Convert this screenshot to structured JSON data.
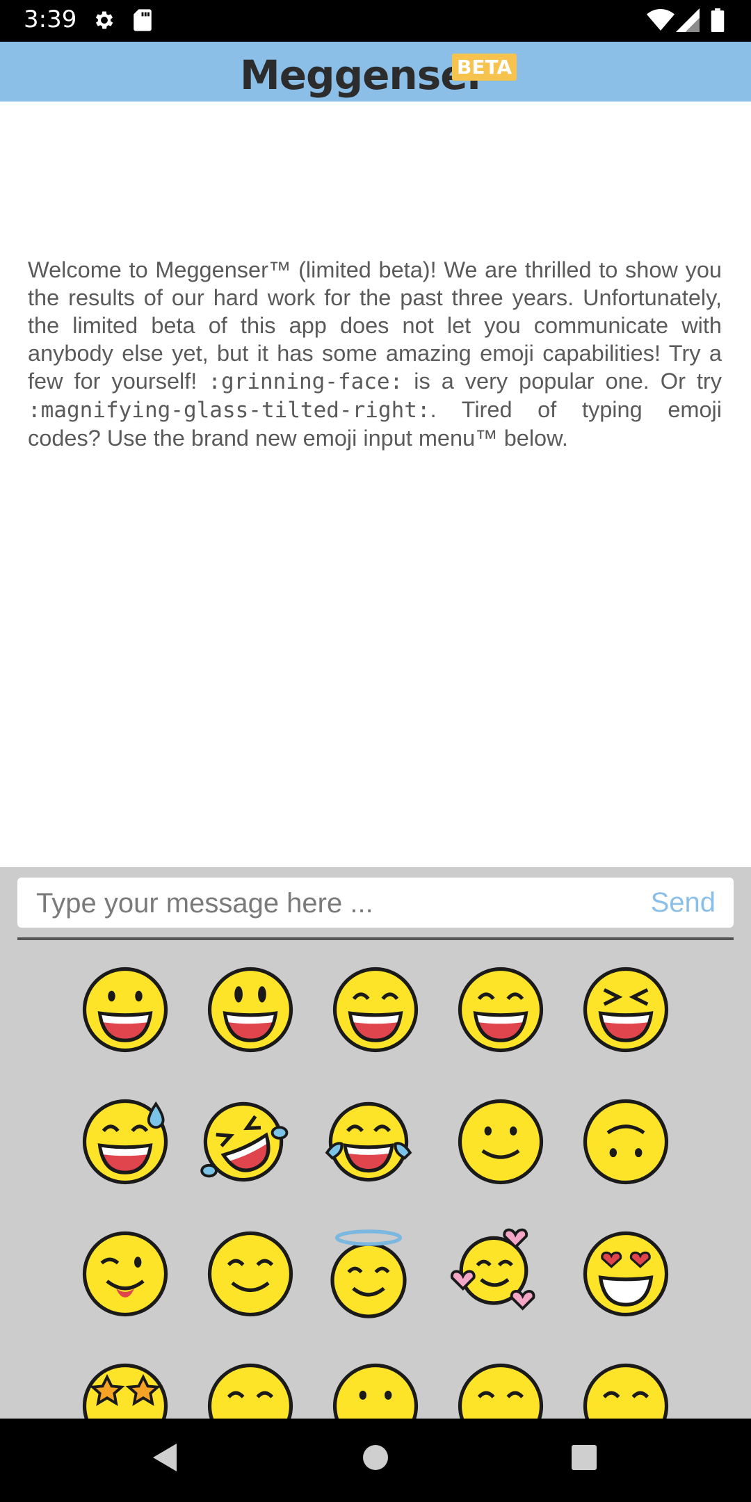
{
  "status_bar": {
    "time": "3:39",
    "icons": [
      "gear-icon",
      "sd-card-icon",
      "wifi-icon",
      "signal-icon",
      "battery-icon"
    ]
  },
  "app_bar": {
    "title": "Meggenser",
    "badge": "BETA",
    "background": "#8bbfe8",
    "badge_color": "#f6c34e"
  },
  "welcome": {
    "part1": "Welcome to Meggenser™ (limited beta)! We are thrilled to show you the results of our hard work for the past three years. Unfortunately, the limited beta of this app does not let you communicate with anybody else yet, but it has some amazing emoji capabilities! Try a few for yourself! ",
    "code1": ":grinning-face:",
    "part2": " is a very popular one. Or try ",
    "code2": ":magnifying-glass-tilted-right:",
    "part3": ". Tired of typing emoji codes? Use the brand new emoji input menu™ below."
  },
  "composer": {
    "placeholder": "Type your message here ...",
    "send_label": "Send"
  },
  "emoji_grid": {
    "rows": [
      [
        "grinning-face",
        "grinning-face-big-eyes",
        "grinning-squinting-face",
        "beaming-face",
        "squinting-face-x-eyes"
      ],
      [
        "grinning-face-sweat",
        "rolling-on-floor-laughing",
        "face-with-tears-of-joy",
        "slightly-smiling-face",
        "upside-down-face"
      ],
      [
        "winking-face",
        "smiling-face-smiling-eyes",
        "smiling-face-halo",
        "smiling-face-hearts",
        "smiling-face-heart-eyes"
      ],
      [
        "star-struck",
        "face-partial",
        "face-partial",
        "face-partial",
        "face-partial"
      ]
    ]
  },
  "nav_bar": {
    "buttons": [
      "back-icon",
      "home-icon",
      "recents-icon"
    ]
  }
}
